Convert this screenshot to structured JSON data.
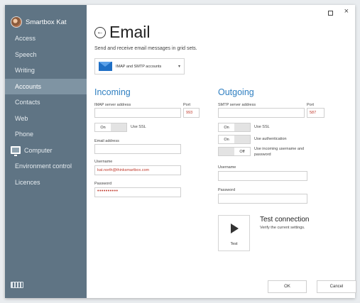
{
  "sidebar": {
    "user_name": "Smartbox Kat",
    "items": [
      {
        "label": "Access"
      },
      {
        "label": "Speech"
      },
      {
        "label": "Writing"
      },
      {
        "label": "Accounts"
      },
      {
        "label": "Contacts"
      },
      {
        "label": "Web"
      },
      {
        "label": "Phone"
      },
      {
        "label": "Computer"
      },
      {
        "label": "Environment control"
      },
      {
        "label": "Licences"
      }
    ],
    "active_item": "Accounts"
  },
  "window_controls": {
    "close_label": "×"
  },
  "header": {
    "title": "Email",
    "subtitle": "Send and receive email messages in grid sets.",
    "account_type": "IMAP and SMTP accounts",
    "account_type_caret": "▾",
    "back_glyph": "←"
  },
  "incoming": {
    "title": "Incoming",
    "server_label": "IMAP server address",
    "server_value": "",
    "port_label": "Port",
    "port_value": "993",
    "ssl_toggle": "On",
    "ssl_label": "Use SSL",
    "email_label": "Email address",
    "email_value": "",
    "username_label": "Username",
    "username_value": "kat.north@thinksmartbox.com",
    "password_label": "Password",
    "password_value": "••••••••••"
  },
  "outgoing": {
    "title": "Outgoing",
    "server_label": "SMTP server address",
    "server_value": "",
    "port_label": "Port",
    "port_value": "587",
    "ssl_toggle": "On",
    "ssl_label": "Use SSL",
    "auth_toggle": "On",
    "auth_label": "Use authentication",
    "reuse_toggle": "Off",
    "reuse_label": "Use incoming username and password",
    "username_label": "Username",
    "username_value": "",
    "password_label": "Password",
    "password_value": ""
  },
  "test": {
    "button_label": "Test",
    "title": "Test connection",
    "description": "Verify the current settings."
  },
  "footer": {
    "ok_label": "OK",
    "cancel_label": "Cancel"
  },
  "colors": {
    "sidebar_bg": "#5f7484",
    "sidebar_active": "#7f94a3",
    "accent_blue": "#2f7fc1",
    "value_red": "#c0392b"
  }
}
